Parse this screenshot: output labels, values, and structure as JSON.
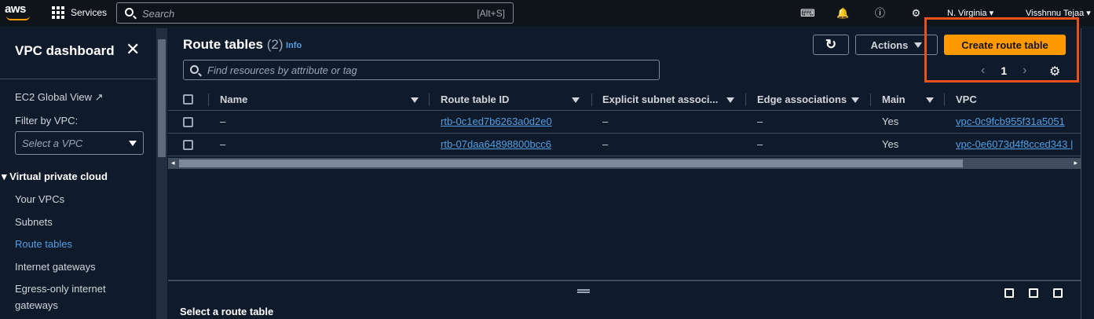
{
  "topbar": {
    "logo": "aws",
    "services": "Services",
    "search_placeholder": "Search",
    "search_shortcut": "[Alt+S]",
    "region": "N. Virginia ▾",
    "user": "Visshnnu Tejaa ▾"
  },
  "sidebar": {
    "title": "VPC dashboard",
    "ec2_global_view": "EC2 Global View",
    "filter_label": "Filter by VPC:",
    "filter_placeholder": "Select a VPC",
    "section": "Virtual private cloud",
    "items": [
      {
        "label": "Your VPCs"
      },
      {
        "label": "Subnets"
      },
      {
        "label": "Route tables"
      },
      {
        "label": "Internet gateways"
      },
      {
        "label": "Egress-only internet"
      },
      {
        "label": "gateways"
      }
    ]
  },
  "main": {
    "title": "Route tables",
    "count": "(2)",
    "info": "Info",
    "actions_label": "Actions",
    "create_label": "Create route table",
    "filter_placeholder": "Find resources by attribute or tag",
    "page": "1",
    "columns": [
      "Name",
      "Route table ID",
      "Explicit subnet associ...",
      "Edge associations",
      "Main",
      "VPC"
    ],
    "rows": [
      {
        "name": "–",
        "id": "rtb-0c1ed7b6263a0d2e0",
        "explicit": "–",
        "edge": "–",
        "main": "Yes",
        "vpc": "vpc-0c9fcb955f31a5051"
      },
      {
        "name": "–",
        "id": "rtb-07daa64898800bcc6",
        "explicit": "–",
        "edge": "–",
        "main": "Yes",
        "vpc": "vpc-0e6073d4f8cced343 |"
      }
    ],
    "bottom_title": "Select a route table"
  },
  "colors": {
    "accent": "#ff9900",
    "link": "#539fe5",
    "highlight": "#e8521a"
  }
}
